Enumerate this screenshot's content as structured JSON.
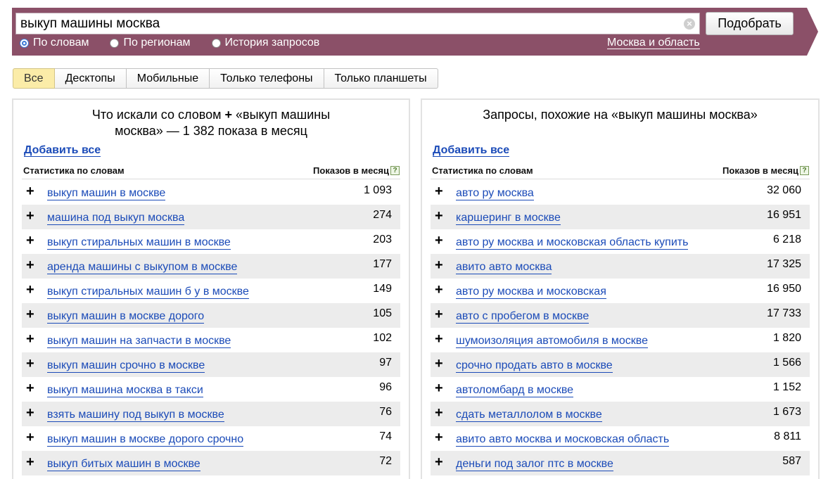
{
  "search": {
    "query": "выкуп машины москва",
    "submit_label": "Подобрать",
    "modes": [
      {
        "label": "По словам",
        "checked": true
      },
      {
        "label": "По регионам",
        "checked": false
      },
      {
        "label": "История запросов",
        "checked": false
      }
    ],
    "region": "Москва и область"
  },
  "tabs": [
    {
      "label": "Все",
      "active": true
    },
    {
      "label": "Десктопы",
      "active": false
    },
    {
      "label": "Мобильные",
      "active": false
    },
    {
      "label": "Только телефоны",
      "active": false
    },
    {
      "label": "Только планшеты",
      "active": false
    }
  ],
  "left_panel": {
    "title_line1_before": "Что искали со словом",
    "title_plus": "+",
    "title_line1_after": "«выкуп машины",
    "title_line2": "москва» — 1 382 показа в месяц",
    "add_all": "Добавить все",
    "col_stats": "Статистика по словам",
    "col_count": "Показов в месяц",
    "help": "?",
    "rows": [
      {
        "plus": "+",
        "query": "выкуп машин в москве",
        "count": "1 093"
      },
      {
        "plus": "+",
        "query": "машина под выкуп москва",
        "count": "274"
      },
      {
        "plus": "+",
        "query": "выкуп стиральных машин в москве",
        "count": "203"
      },
      {
        "plus": "+",
        "query": "аренда машины с выкупом в москве",
        "count": "177"
      },
      {
        "plus": "+",
        "query": "выкуп стиральных машин б у в москве",
        "count": "149"
      },
      {
        "plus": "+",
        "query": "выкуп машин в москве дорого",
        "count": "105"
      },
      {
        "plus": "+",
        "query": "выкуп машин на запчасти в москве",
        "count": "102"
      },
      {
        "plus": "+",
        "query": "выкуп машин срочно в москве",
        "count": "97"
      },
      {
        "plus": "+",
        "query": "выкуп машина москва в такси",
        "count": "96"
      },
      {
        "plus": "+",
        "query": "взять машину под выкуп в москве",
        "count": "76"
      },
      {
        "plus": "+",
        "query": "выкуп машин в москве дорого срочно",
        "count": "74"
      },
      {
        "plus": "+",
        "query": "выкуп битых машин в москве",
        "count": "72"
      }
    ]
  },
  "right_panel": {
    "title": "Запросы, похожие на «выкуп машины москва»",
    "add_all": "Добавить все",
    "col_stats": "Статистика по словам",
    "col_count": "Показов в месяц",
    "help": "?",
    "rows": [
      {
        "plus": "+",
        "query": "авто ру москва",
        "count": "32 060"
      },
      {
        "plus": "+",
        "query": "каршеринг в москве",
        "count": "16 951"
      },
      {
        "plus": "+",
        "query": "авто ру москва и московская область купить",
        "count": "6 218"
      },
      {
        "plus": "+",
        "query": "авито авто москва",
        "count": "17 325"
      },
      {
        "plus": "+",
        "query": "авто ру москва и московская",
        "count": "16 950"
      },
      {
        "plus": "+",
        "query": "авто с пробегом в москве",
        "count": "17 733"
      },
      {
        "plus": "+",
        "query": "шумоизоляция автомобиля в москве",
        "count": "1 820"
      },
      {
        "plus": "+",
        "query": "срочно продать авто в москве",
        "count": "1 566"
      },
      {
        "plus": "+",
        "query": "автоломбард в москве",
        "count": "1 152"
      },
      {
        "plus": "+",
        "query": "сдать металлолом в москве",
        "count": "1 673"
      },
      {
        "plus": "+",
        "query": "авито авто москва и московская область",
        "count": "8 811"
      },
      {
        "plus": "+",
        "query": "деньги под залог птс в москве",
        "count": "587"
      }
    ]
  }
}
